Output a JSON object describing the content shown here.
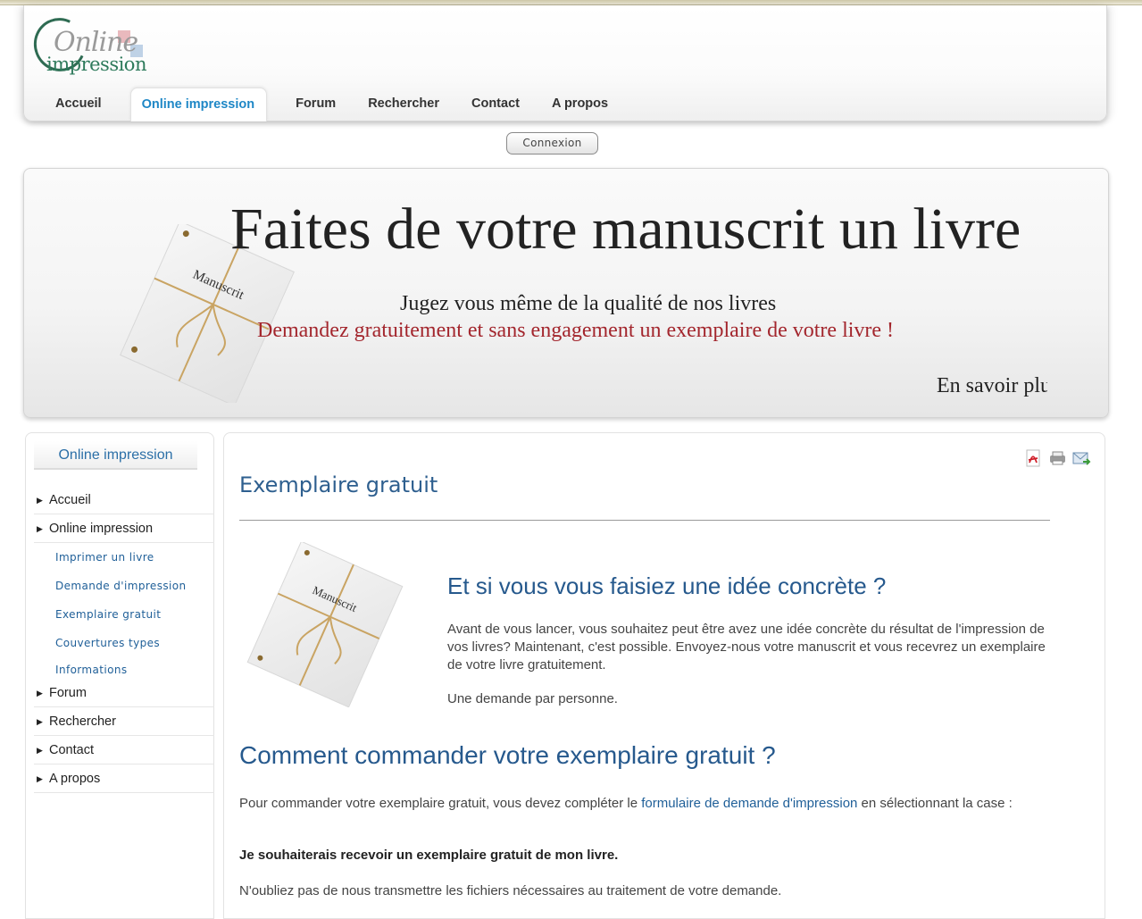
{
  "logo": {
    "line1": "Online",
    "line2": "impression"
  },
  "nav": {
    "items": [
      {
        "label": "Accueil"
      },
      {
        "label": "Online impression",
        "active": true
      },
      {
        "label": "Forum"
      },
      {
        "label": "Rechercher"
      },
      {
        "label": "Contact"
      },
      {
        "label": "A propos"
      }
    ]
  },
  "login": {
    "label": "Connexion"
  },
  "banner": {
    "title": "Faites de votre manuscrit un livre",
    "subtitle": "Jugez vous même de la qualité de nos livres",
    "cta": "Demandez gratuitement et sans engagement un exemplaire de votre livre !",
    "more": "En savoir plus",
    "image_label": "Manuscrit"
  },
  "sidebar": {
    "title": "Online impression",
    "items": [
      {
        "label": "Accueil"
      },
      {
        "label": "Online impression"
      }
    ],
    "subitems": [
      {
        "label": "Imprimer un livre"
      },
      {
        "label": "Demande d'impression"
      },
      {
        "label": "Exemplaire gratuit"
      },
      {
        "label": "Couvertures types"
      },
      {
        "label": "Informations"
      }
    ],
    "items_after": [
      {
        "label": "Forum"
      },
      {
        "label": "Rechercher"
      },
      {
        "label": "Contact"
      },
      {
        "label": "A propos"
      }
    ]
  },
  "main": {
    "icons": [
      "pdf-icon",
      "print-icon",
      "email-icon"
    ],
    "page_title": "Exemplaire gratuit",
    "image_label": "Manuscrit",
    "heading1": "Et si vous vous faisiez une idée concrète ?",
    "para1": "Avant de vous lancer, vous souhaitez peut être avez une idée concrète du résultat de l'impression de vos livres? Maintenant, c'est possible. Envoyez-nous votre manuscrit et vous recevrez un exemplaire de votre livre gratuitement.",
    "para2": "Une demande par personne.",
    "heading2": "Comment commander votre exemplaire gratuit ?",
    "para3_before": "Pour commander votre exemplaire gratuit, vous devez compléter le ",
    "para3_link": "formulaire de demande d'impression",
    "para3_after": " en sélectionnant la case :",
    "para4": "Je souhaiterais recevoir un exemplaire gratuit de mon livre.",
    "para5": "N'oubliez pas de nous transmettre les fichiers nécessaires au traitement de votre demande."
  },
  "colors": {
    "accent": "#1e87c6",
    "link": "#1f5f98",
    "heading": "#26598d",
    "banner_red": "#a3262d",
    "logo_green": "#2e7a5b"
  }
}
